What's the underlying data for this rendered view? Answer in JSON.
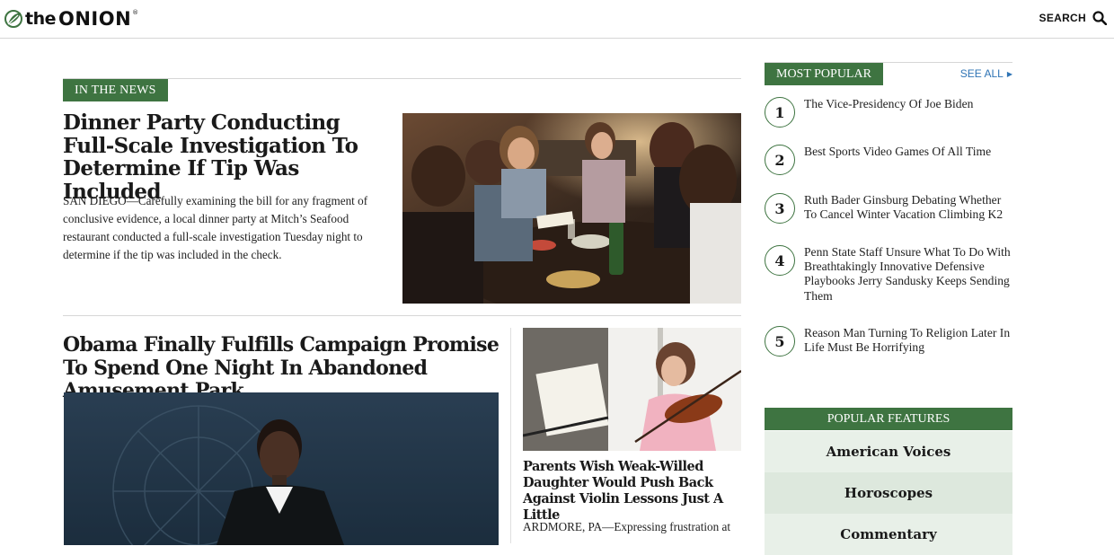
{
  "header": {
    "logo_the": "the",
    "logo_onion": "ONION",
    "logo_reg": "®",
    "search_label": "SEARCH",
    "logo_icon": "onion-leaf-icon",
    "search_icon": "magnifier-icon"
  },
  "colors": {
    "brand_green": "#3e7441",
    "link_blue": "#2f74b5",
    "divider": "#d6d6d6"
  },
  "in_the_news": {
    "tag": "IN THE NEWS",
    "headline": "Dinner Party Conducting Full-Scale Investigation To Determine If Tip Was Included",
    "body": "SAN DIEGO—Carefully examining the bill for any fragment of conclusive evidence, a local dinner party at Mitch’s Seafood restaurant conducted a full-scale investigation Tuesday night to determine if the tip was included in the check."
  },
  "obama": {
    "headline": "Obama Finally Fulfills Campaign Promise To Spend One Night In Abandoned Amusement Park"
  },
  "violin": {
    "headline": "Parents Wish Weak-Willed Daughter Would Push Back Against Violin Lessons Just A Little",
    "body": "ARDMORE, PA—Expressing frustration at"
  },
  "most_popular": {
    "tag": "MOST POPULAR",
    "see_all": "SEE ALL",
    "items": [
      {
        "num": "1",
        "text": "The Vice-Presidency Of Joe Biden"
      },
      {
        "num": "2",
        "text": "Best Sports Video Games Of All Time"
      },
      {
        "num": "3",
        "text": "Ruth Bader Ginsburg Debating Whether To Cancel Winter Vacation Climbing K2"
      },
      {
        "num": "4",
        "text": "Penn State Staff Unsure What To Do With Breathtakingly Innovative Defensive Playbooks Jerry Sandusky Keeps Sending Them"
      },
      {
        "num": "5",
        "text": "Reason Man Turning To Religion Later In Life Must Be Horrifying"
      }
    ]
  },
  "popular_features": {
    "header": "POPULAR FEATURES",
    "items": [
      {
        "label": "American Voices",
        "bg": "#e8f0e8"
      },
      {
        "label": "Horoscopes",
        "bg": "#dde8dd"
      },
      {
        "label": "Commentary",
        "bg": "#e8f0e8"
      }
    ]
  }
}
